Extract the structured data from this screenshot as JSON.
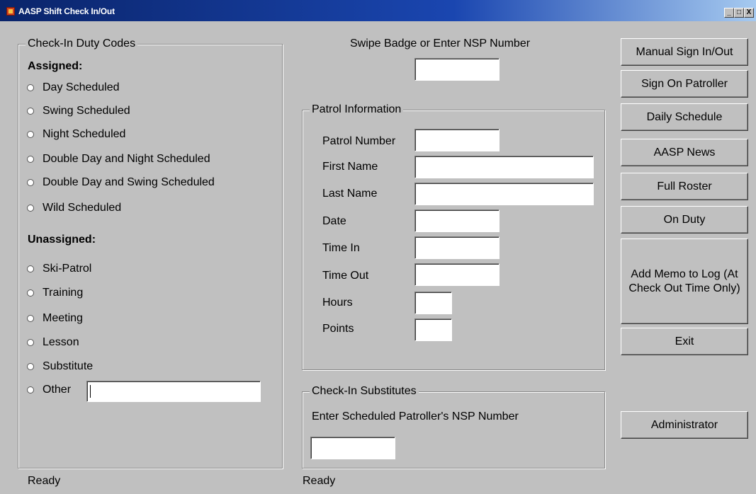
{
  "window": {
    "title": "AASP Shift Check In/Out",
    "minimize": "_",
    "maximize": "□",
    "close": "X"
  },
  "duty_codes": {
    "legend": "Check-In Duty Codes",
    "assigned_heading": "Assigned:",
    "assigned": [
      "Day Scheduled",
      "Swing Scheduled",
      "Night Scheduled",
      "Double Day and Night Scheduled",
      "Double Day and Swing Scheduled",
      "Wild Scheduled"
    ],
    "unassigned_heading": "Unassigned:",
    "unassigned": [
      "Ski-Patrol",
      "Training",
      "Meeting",
      "Lesson",
      "Substitute",
      "Other"
    ],
    "other_value": ""
  },
  "badge": {
    "prompt": "Swipe Badge or Enter NSP Number",
    "value": ""
  },
  "patrol": {
    "legend": "Patrol Information",
    "fields": {
      "patrol_number": {
        "label": "Patrol Number",
        "value": ""
      },
      "first_name": {
        "label": "First Name",
        "value": ""
      },
      "last_name": {
        "label": "Last Name",
        "value": ""
      },
      "date": {
        "label": "Date",
        "value": ""
      },
      "time_in": {
        "label": "Time In",
        "value": ""
      },
      "time_out": {
        "label": "Time Out",
        "value": ""
      },
      "hours": {
        "label": "Hours",
        "value": ""
      },
      "points": {
        "label": "Points",
        "value": ""
      }
    }
  },
  "substitutes": {
    "legend": "Check-In Substitutes",
    "prompt": "Enter Scheduled Patroller's NSP Number",
    "value": ""
  },
  "buttons": {
    "manual_sign": "Manual Sign In/Out",
    "sign_on_patroller": "Sign On Patroller",
    "daily_schedule": "Daily Schedule",
    "aasp_news": "AASP News",
    "full_roster": "Full Roster",
    "on_duty": "On Duty",
    "add_memo": "Add Memo to Log (At Check Out Time Only)",
    "exit": "Exit",
    "administrator": "Administrator"
  },
  "status": {
    "left": "Ready",
    "right": "Ready"
  }
}
